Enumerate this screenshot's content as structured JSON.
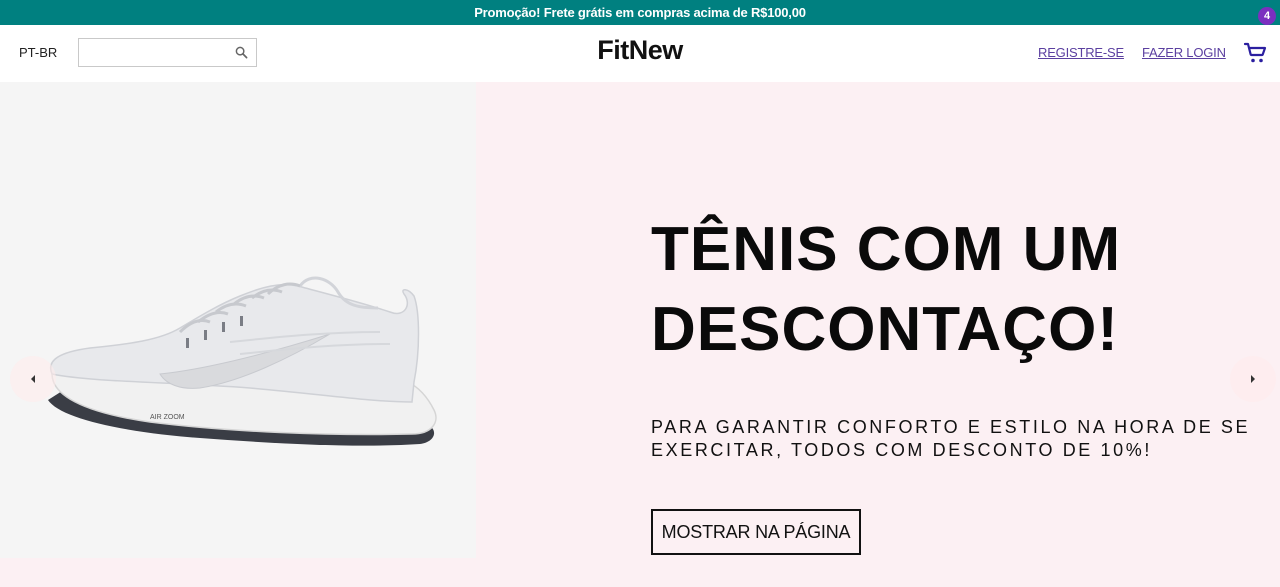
{
  "promo": {
    "text": "Promoção! Frete grátis em compras acima de R$100,00"
  },
  "header": {
    "language": "PT-BR",
    "search": {
      "value": "",
      "placeholder": "",
      "icon": "search-icon"
    },
    "brand": "FitNew",
    "register_label": "REGISTRE-SE",
    "login_label": "FAZER LOGIN",
    "cart": {
      "icon": "cart-icon",
      "count": "4"
    }
  },
  "hero": {
    "title_line1": "TÊNIS COM UM",
    "title_line2": "DESCONTAÇO!",
    "subtitle": "PARA GARANTIR CONFORTO E ESTILO NA HORA DE SE EXERCITAR, TODOS COM DESCONTO DE 10%!",
    "button_label": "MOSTRAR NA PÁGINA",
    "shoe_label": "AIR ZOOM",
    "prev_icon": "chevron-left-icon",
    "next_icon": "chevron-right-icon"
  },
  "colors": {
    "promo_bg": "#008080",
    "hero_bg": "#fcf0f3",
    "link": "#5b3fa0",
    "badge": "#7b2fbf",
    "cart_icon": "#2b1fa0"
  }
}
